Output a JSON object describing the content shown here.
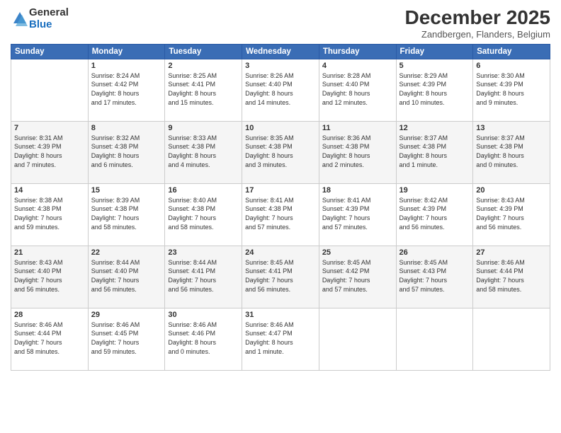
{
  "logo": {
    "general": "General",
    "blue": "Blue"
  },
  "header": {
    "month": "December 2025",
    "location": "Zandbergen, Flanders, Belgium"
  },
  "weekdays": [
    "Sunday",
    "Monday",
    "Tuesday",
    "Wednesday",
    "Thursday",
    "Friday",
    "Saturday"
  ],
  "weeks": [
    [
      {
        "day": "",
        "info": ""
      },
      {
        "day": "1",
        "info": "Sunrise: 8:24 AM\nSunset: 4:42 PM\nDaylight: 8 hours\nand 17 minutes."
      },
      {
        "day": "2",
        "info": "Sunrise: 8:25 AM\nSunset: 4:41 PM\nDaylight: 8 hours\nand 15 minutes."
      },
      {
        "day": "3",
        "info": "Sunrise: 8:26 AM\nSunset: 4:40 PM\nDaylight: 8 hours\nand 14 minutes."
      },
      {
        "day": "4",
        "info": "Sunrise: 8:28 AM\nSunset: 4:40 PM\nDaylight: 8 hours\nand 12 minutes."
      },
      {
        "day": "5",
        "info": "Sunrise: 8:29 AM\nSunset: 4:39 PM\nDaylight: 8 hours\nand 10 minutes."
      },
      {
        "day": "6",
        "info": "Sunrise: 8:30 AM\nSunset: 4:39 PM\nDaylight: 8 hours\nand 9 minutes."
      }
    ],
    [
      {
        "day": "7",
        "info": "Sunrise: 8:31 AM\nSunset: 4:39 PM\nDaylight: 8 hours\nand 7 minutes."
      },
      {
        "day": "8",
        "info": "Sunrise: 8:32 AM\nSunset: 4:38 PM\nDaylight: 8 hours\nand 6 minutes."
      },
      {
        "day": "9",
        "info": "Sunrise: 8:33 AM\nSunset: 4:38 PM\nDaylight: 8 hours\nand 4 minutes."
      },
      {
        "day": "10",
        "info": "Sunrise: 8:35 AM\nSunset: 4:38 PM\nDaylight: 8 hours\nand 3 minutes."
      },
      {
        "day": "11",
        "info": "Sunrise: 8:36 AM\nSunset: 4:38 PM\nDaylight: 8 hours\nand 2 minutes."
      },
      {
        "day": "12",
        "info": "Sunrise: 8:37 AM\nSunset: 4:38 PM\nDaylight: 8 hours\nand 1 minute."
      },
      {
        "day": "13",
        "info": "Sunrise: 8:37 AM\nSunset: 4:38 PM\nDaylight: 8 hours\nand 0 minutes."
      }
    ],
    [
      {
        "day": "14",
        "info": "Sunrise: 8:38 AM\nSunset: 4:38 PM\nDaylight: 7 hours\nand 59 minutes."
      },
      {
        "day": "15",
        "info": "Sunrise: 8:39 AM\nSunset: 4:38 PM\nDaylight: 7 hours\nand 58 minutes."
      },
      {
        "day": "16",
        "info": "Sunrise: 8:40 AM\nSunset: 4:38 PM\nDaylight: 7 hours\nand 58 minutes."
      },
      {
        "day": "17",
        "info": "Sunrise: 8:41 AM\nSunset: 4:38 PM\nDaylight: 7 hours\nand 57 minutes."
      },
      {
        "day": "18",
        "info": "Sunrise: 8:41 AM\nSunset: 4:39 PM\nDaylight: 7 hours\nand 57 minutes."
      },
      {
        "day": "19",
        "info": "Sunrise: 8:42 AM\nSunset: 4:39 PM\nDaylight: 7 hours\nand 56 minutes."
      },
      {
        "day": "20",
        "info": "Sunrise: 8:43 AM\nSunset: 4:39 PM\nDaylight: 7 hours\nand 56 minutes."
      }
    ],
    [
      {
        "day": "21",
        "info": "Sunrise: 8:43 AM\nSunset: 4:40 PM\nDaylight: 7 hours\nand 56 minutes."
      },
      {
        "day": "22",
        "info": "Sunrise: 8:44 AM\nSunset: 4:40 PM\nDaylight: 7 hours\nand 56 minutes."
      },
      {
        "day": "23",
        "info": "Sunrise: 8:44 AM\nSunset: 4:41 PM\nDaylight: 7 hours\nand 56 minutes."
      },
      {
        "day": "24",
        "info": "Sunrise: 8:45 AM\nSunset: 4:41 PM\nDaylight: 7 hours\nand 56 minutes."
      },
      {
        "day": "25",
        "info": "Sunrise: 8:45 AM\nSunset: 4:42 PM\nDaylight: 7 hours\nand 57 minutes."
      },
      {
        "day": "26",
        "info": "Sunrise: 8:45 AM\nSunset: 4:43 PM\nDaylight: 7 hours\nand 57 minutes."
      },
      {
        "day": "27",
        "info": "Sunrise: 8:46 AM\nSunset: 4:44 PM\nDaylight: 7 hours\nand 58 minutes."
      }
    ],
    [
      {
        "day": "28",
        "info": "Sunrise: 8:46 AM\nSunset: 4:44 PM\nDaylight: 7 hours\nand 58 minutes."
      },
      {
        "day": "29",
        "info": "Sunrise: 8:46 AM\nSunset: 4:45 PM\nDaylight: 7 hours\nand 59 minutes."
      },
      {
        "day": "30",
        "info": "Sunrise: 8:46 AM\nSunset: 4:46 PM\nDaylight: 8 hours\nand 0 minutes."
      },
      {
        "day": "31",
        "info": "Sunrise: 8:46 AM\nSunset: 4:47 PM\nDaylight: 8 hours\nand 1 minute."
      },
      {
        "day": "",
        "info": ""
      },
      {
        "day": "",
        "info": ""
      },
      {
        "day": "",
        "info": ""
      }
    ]
  ]
}
